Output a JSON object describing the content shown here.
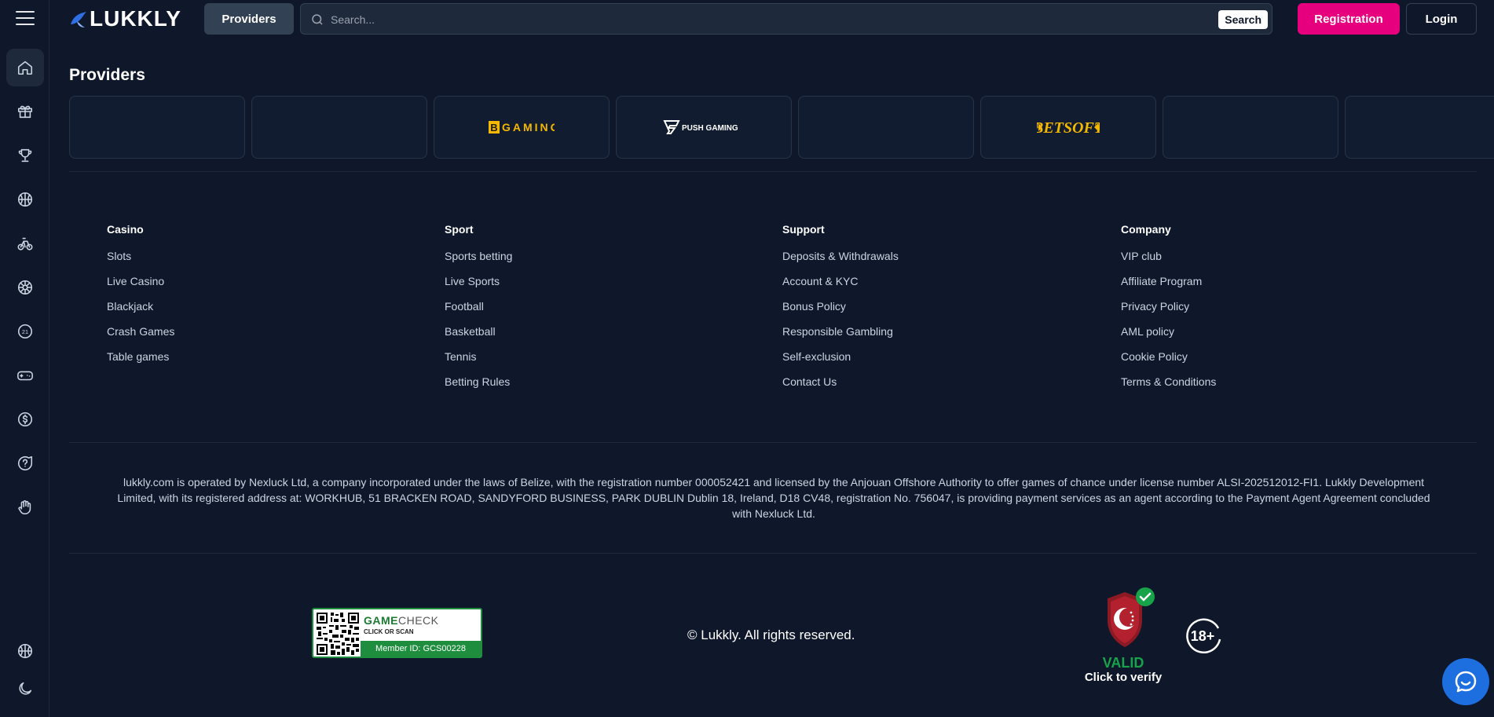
{
  "brand": {
    "name": "LUKKLY"
  },
  "header": {
    "providers_label": "Providers",
    "search_placeholder": "Search...",
    "search_button": "Search",
    "registration_label": "Registration",
    "login_label": "Login"
  },
  "sidebar": {
    "items": [
      {
        "icon": "home-icon",
        "active": true
      },
      {
        "icon": "gift-icon",
        "active": false
      },
      {
        "icon": "trophy-icon",
        "active": false
      },
      {
        "icon": "basketball-icon",
        "active": false
      },
      {
        "icon": "bicycle-icon",
        "active": false
      },
      {
        "icon": "wheel-icon",
        "active": false
      },
      {
        "icon": "blackjack-21-icon",
        "active": false
      },
      {
        "icon": "gamepad-icon",
        "active": false
      },
      {
        "icon": "coin-icon",
        "active": false
      },
      {
        "icon": "help-icon",
        "active": false
      },
      {
        "icon": "hand-icon",
        "active": false
      }
    ],
    "bottom": [
      {
        "icon": "basketball-icon"
      },
      {
        "icon": "moon-icon"
      }
    ]
  },
  "providers": {
    "title": "Providers",
    "cards": [
      {
        "name": "",
        "logo": ""
      },
      {
        "name": "",
        "logo": ""
      },
      {
        "name": "BGAMING",
        "logo": "bgaming-logo"
      },
      {
        "name": "PUSH GAMING",
        "logo": "push-gaming-logo"
      },
      {
        "name": "",
        "logo": ""
      },
      {
        "name": "BETSOFT",
        "logo": "betsoft-logo"
      },
      {
        "name": "",
        "logo": ""
      },
      {
        "name": "",
        "logo": ""
      }
    ]
  },
  "footer": {
    "columns": [
      {
        "title": "Casino",
        "links": [
          "Slots",
          "Live Casino",
          "Blackjack",
          "Crash Games",
          "Table games"
        ]
      },
      {
        "title": "Sport",
        "links": [
          "Sports betting",
          "Live Sports",
          "Football",
          "Basketball",
          "Tennis",
          "Betting Rules"
        ]
      },
      {
        "title": "Support",
        "links": [
          "Deposits & Withdrawals",
          "Account & KYC",
          "Bonus Policy",
          "Responsible Gambling",
          "Self-exclusion",
          "Contact Us"
        ]
      },
      {
        "title": "Company",
        "links": [
          "VIP club",
          "Affiliate Program",
          "Privacy Policy",
          "AML policy",
          "Cookie Policy",
          "Terms & Conditions"
        ]
      }
    ],
    "legal_text": "lukkly.com is operated by Nexluck Ltd, a company incorporated under the laws of Belize, with the registration number 000052421 and licensed by the Anjouan Offshore Authority to offer games of chance under license number ALSI-202512012-FI1. Lukkly Development Limited, with its registered address at: WORKHUB, 51 BRACKEN ROAD, SANDYFORD BUSINESS, PARK DUBLIN Dublin 18, Ireland, D18 CV48, registration No. 756047, is providing payment services as an agent according to the Payment Agent Agreement concluded with Nexluck Ltd.",
    "gamecheck": {
      "brand_a": "GAME",
      "brand_b": "CHECK",
      "sub": "CLICK OR SCAN",
      "member": "Member ID: GCS00228"
    },
    "copyright": "© Lukkly. All rights reserved.",
    "license_badge": {
      "status": "VALID",
      "action": "Click to verify"
    },
    "age": "18+"
  },
  "colors": {
    "background": "#0f172a",
    "accent": "#e6007e",
    "valid": "#16a34a",
    "chat": "#1d6fe0"
  }
}
